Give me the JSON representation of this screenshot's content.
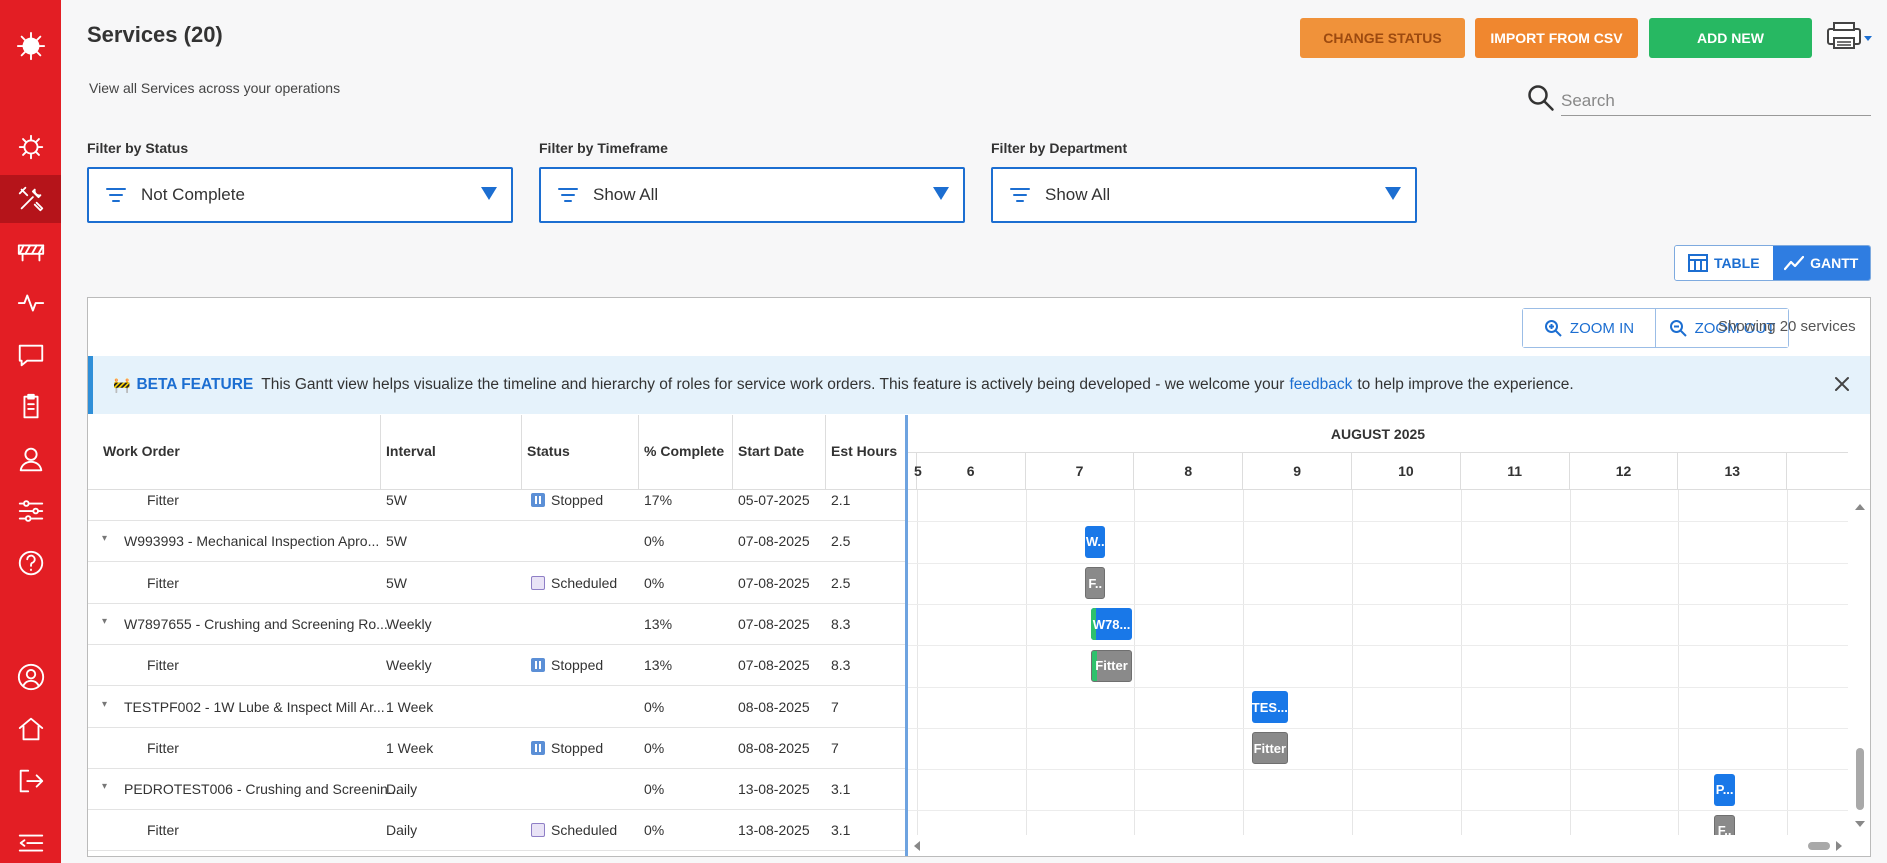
{
  "header": {
    "title": "Services (20)",
    "subtitle": "View all Services across your operations"
  },
  "toolbar": {
    "change_status_label": "CHANGE STATUS",
    "import_label": "IMPORT FROM CSV",
    "add_label": "ADD NEW"
  },
  "search": {
    "placeholder": "Search",
    "value": ""
  },
  "filters": {
    "status": {
      "label": "Filter by Status",
      "value": "Not Complete"
    },
    "timeframe": {
      "label": "Filter by Timeframe",
      "value": "Show All"
    },
    "department": {
      "label": "Filter by Department",
      "value": "Show All"
    }
  },
  "view_toggle": {
    "table_label": "TABLE",
    "gantt_label": "GANTT",
    "active": "GANTT"
  },
  "gantt": {
    "zoom_in_label": "ZOOM IN",
    "zoom_out_label": "ZOOM OUT",
    "showing_text": "Showing 20 services",
    "beta": {
      "tag": "BETA FEATURE",
      "text_before": "This Gantt view helps visualize the timeline and hierarchy of roles for service work orders. This feature is actively being developed - we welcome your",
      "link": "feedback",
      "text_after": "to help improve the experience."
    },
    "columns": {
      "work_order": "Work Order",
      "interval": "Interval",
      "status": "Status",
      "complete": "% Complete",
      "start_date": "Start Date",
      "est_hours": "Est Hours"
    },
    "month": "AUGUST 2025",
    "days": [
      "5",
      "6",
      "7",
      "8",
      "9",
      "10",
      "11",
      "12",
      "13"
    ],
    "rows": [
      {
        "type": "role",
        "name": "Fitter",
        "interval": "5W",
        "status": "Stopped",
        "complete": "17%",
        "start": "05-07-2025",
        "hours": "2.1"
      },
      {
        "type": "wo",
        "name": "W993993 - Mechanical Inspection Apro...",
        "interval": "5W",
        "status": "",
        "complete": "0%",
        "start": "07-08-2025",
        "hours": "2.5"
      },
      {
        "type": "role",
        "name": "Fitter",
        "interval": "5W",
        "status": "Scheduled",
        "complete": "0%",
        "start": "07-08-2025",
        "hours": "2.5"
      },
      {
        "type": "wo",
        "name": "W7897655 - Crushing and Screening Ro...",
        "interval": "Weekly",
        "status": "",
        "complete": "13%",
        "start": "07-08-2025",
        "hours": "8.3"
      },
      {
        "type": "role",
        "name": "Fitter",
        "interval": "Weekly",
        "status": "Stopped",
        "complete": "13%",
        "start": "07-08-2025",
        "hours": "8.3"
      },
      {
        "type": "wo",
        "name": "TESTPF002 - 1W Lube & Inspect Mill Ar...",
        "interval": "1 Week",
        "status": "",
        "complete": "0%",
        "start": "08-08-2025",
        "hours": "7"
      },
      {
        "type": "role",
        "name": "Fitter",
        "interval": "1 Week",
        "status": "Stopped",
        "complete": "0%",
        "start": "08-08-2025",
        "hours": "7"
      },
      {
        "type": "wo",
        "name": "PEDROTEST006 - Crushing and Screenin...",
        "interval": "Daily",
        "status": "",
        "complete": "0%",
        "start": "13-08-2025",
        "hours": "3.1"
      },
      {
        "type": "role",
        "name": "Fitter",
        "interval": "Daily",
        "status": "Scheduled",
        "complete": "0%",
        "start": "13-08-2025",
        "hours": "3.1"
      }
    ],
    "bars": [
      {
        "row": 1,
        "kind": "wo",
        "label": "W..",
        "day": 7.55,
        "span": 0.18,
        "progress": 0
      },
      {
        "row": 2,
        "kind": "role",
        "label": "F..",
        "day": 7.55,
        "span": 0.18,
        "progress": 0
      },
      {
        "row": 3,
        "kind": "wo",
        "label": "W78...",
        "day": 7.6,
        "span": 0.38,
        "progress": 0.13
      },
      {
        "row": 4,
        "kind": "role",
        "label": "Fitter",
        "day": 7.6,
        "span": 0.38,
        "progress": 0.13
      },
      {
        "row": 5,
        "kind": "wo",
        "label": "TES...",
        "day": 9.08,
        "span": 0.33,
        "progress": 0
      },
      {
        "row": 6,
        "kind": "role",
        "label": "Fitter",
        "day": 9.08,
        "span": 0.33,
        "progress": 0
      },
      {
        "row": 7,
        "kind": "wo",
        "label": "P...",
        "day": 13.33,
        "span": 0.19,
        "progress": 0
      },
      {
        "row": 8,
        "kind": "role",
        "label": "F..",
        "day": 13.33,
        "span": 0.19,
        "progress": 0
      }
    ]
  },
  "colors": {
    "sidebar": "#e31e24",
    "primary": "#1c6ed1",
    "add": "#27b862",
    "import": "#f0872f",
    "bar_wo": "#1978e8",
    "bar_role": "#8a8a8a",
    "progress": "#2ec16c"
  },
  "sidebar_icons": [
    "logo-icon",
    "dashboard-icon",
    "services-icon",
    "barrier-icon",
    "activity-icon",
    "chat-icon",
    "clipboard-icon",
    "user-icon",
    "sliders-icon",
    "help-icon",
    "profile-icon",
    "home-icon",
    "logout-icon",
    "menu-collapse-icon"
  ]
}
